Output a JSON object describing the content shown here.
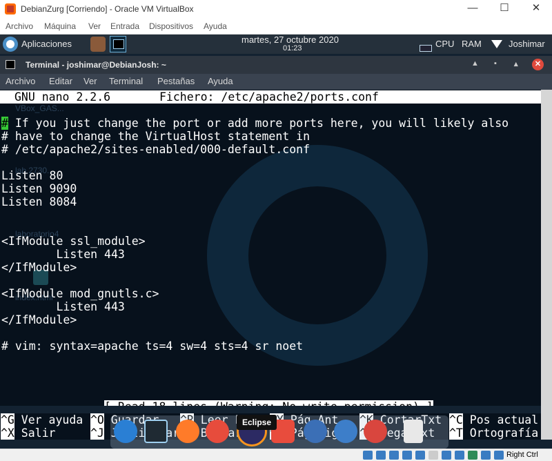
{
  "vbox": {
    "window_title": "DebianZurg [Corriendo] - Oracle VM VirtualBox",
    "controls": {
      "minimize": "—",
      "maximize": "☐",
      "close": "✕"
    },
    "menu": [
      "Archivo",
      "Máquina",
      "Ver",
      "Entrada",
      "Dispositivos",
      "Ayuda"
    ],
    "status_host_key": "Right Ctrl"
  },
  "panel": {
    "apps_label": "Aplicaciones",
    "clock_date": "martes, 27 octubre 2020",
    "clock_time": "01:23",
    "cpu": "CPU",
    "ram": "RAM",
    "user": "Joshimar"
  },
  "terminal": {
    "title": "Terminal - joshimar@DebianJosh: ~",
    "controls": {
      "restore": "▲",
      "minimize": "▪",
      "maximize": "▴",
      "close": "✕"
    },
    "menu": [
      "Archivo",
      "Editar",
      "Ver",
      "Terminal",
      "Pestañas",
      "Ayuda"
    ]
  },
  "desktop_ghosts": {
    "vbox_gas": "VBox_GAS...",
    "lab": "lab 2730...",
    "laboratorio": "laboratorio4",
    "index": "index.html"
  },
  "nano": {
    "header_version": "GNU nano 2.2.6",
    "header_file": "Fichero: /etc/apache2/ports.conf",
    "cursor_char": "#",
    "lines": [
      " If you just change the port or add more ports here, you will likely also",
      "# have to change the VirtualHost statement in",
      "# /etc/apache2/sites-enabled/000-default.conf",
      "",
      "Listen 80",
      "Listen 9090",
      "Listen 8084",
      "",
      "",
      "<IfModule ssl_module>",
      "        Listen 443",
      "</IfModule>",
      "",
      "<IfModule mod_gnutls.c>",
      "        Listen 443",
      "</IfModule>",
      "",
      "# vim: syntax=apache ts=4 sw=4 sts=4 sr noet"
    ],
    "status_message": "[ Read 18 lines (Warning: No write permission) ]",
    "shortcuts_row1": [
      {
        "key": "^G",
        "label": " Ver ayuda"
      },
      {
        "key": "^O",
        "label": " Guardar"
      },
      {
        "key": "^R",
        "label": " Leer Fich"
      },
      {
        "key": "^Y",
        "label": " Pág Ant"
      },
      {
        "key": "^K",
        "label": " CortarTxt"
      },
      {
        "key": "^C",
        "label": " Pos actual"
      }
    ],
    "shortcuts_row2": [
      {
        "key": "^X",
        "label": " Salir"
      },
      {
        "key": "^J",
        "label": " Justificar"
      },
      {
        "key": "^W",
        "label": " Buscar"
      },
      {
        "key": "^V",
        "label": " Pág Sig"
      },
      {
        "key": "^U",
        "label": " PegarTxt"
      },
      {
        "key": "^T",
        "label": " Ortografía"
      }
    ]
  },
  "dock": {
    "tooltip": "Eclipse",
    "items": [
      "anchor-launcher",
      "terminal",
      "firefox",
      "scratch",
      "eclipse",
      "office",
      "pgadmin",
      "wireshark",
      "mail",
      "trash"
    ],
    "colors": [
      "#2a7fd4",
      "#1f2a33",
      "#ff7b29",
      "#e74c3c",
      "#2c2a63",
      "#e84c3d",
      "#3b6fb6",
      "#3d7ec9",
      "#d9463e",
      "#e8e8e8"
    ]
  }
}
